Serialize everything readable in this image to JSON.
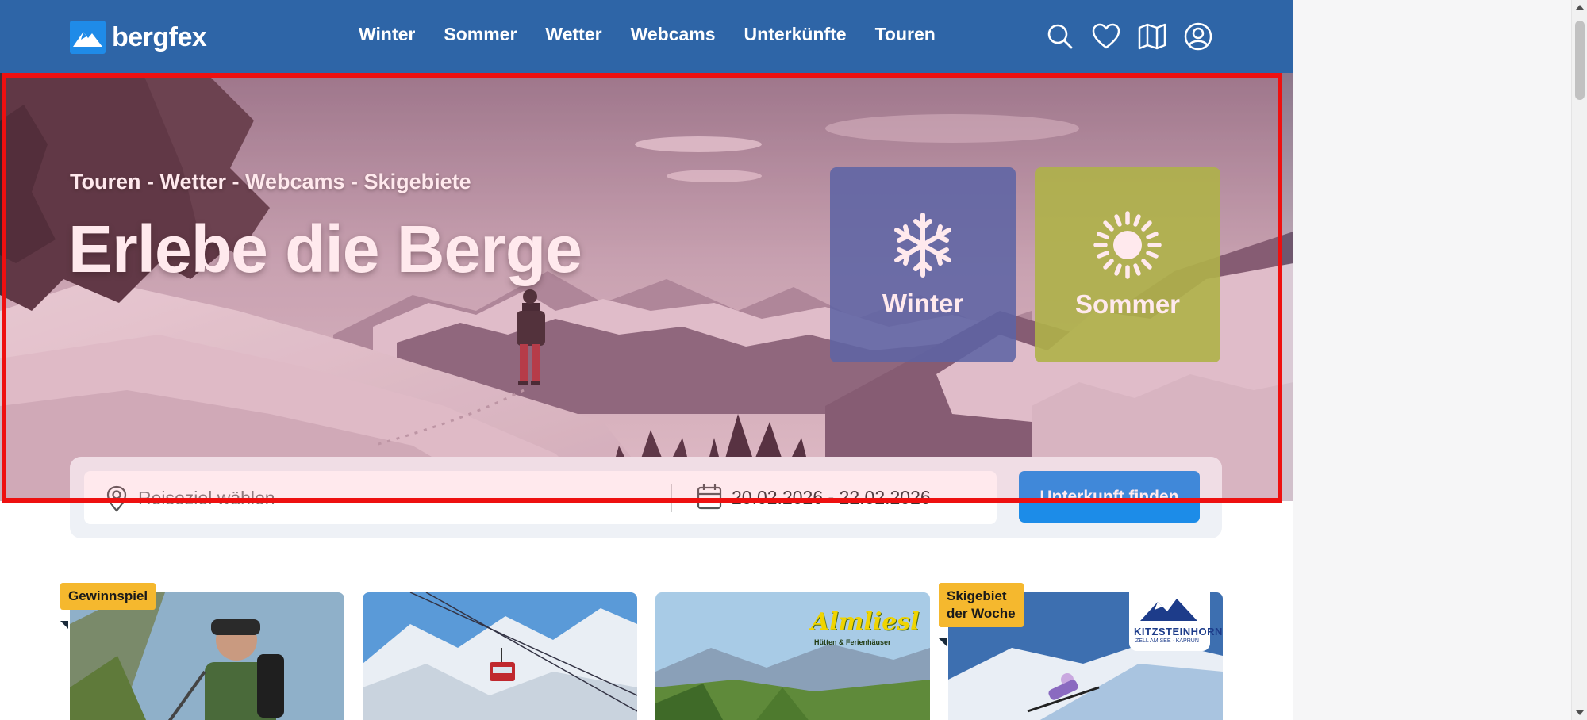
{
  "header": {
    "logo_text": "bergfex",
    "nav": [
      "Winter",
      "Sommer",
      "Wetter",
      "Webcams",
      "Unterkünfte",
      "Touren"
    ],
    "icons": [
      "search-icon",
      "heart-icon",
      "map-icon",
      "user-icon"
    ],
    "bg_color": "#2e65a7"
  },
  "hero": {
    "tagline": "Touren - Wetter - Webcams - Skigebiete",
    "title": "Erlebe die Berge",
    "cards": [
      {
        "label": "Winter",
        "icon": "snowflake-icon",
        "color": "#4061a8"
      },
      {
        "label": "Sommer",
        "icon": "sun-icon",
        "color": "#a0be3c"
      }
    ]
  },
  "search": {
    "destination_placeholder": "Reiseziel wählen",
    "dates": "20.02.2026 - 22.02.2026",
    "button_label": "Unterkunft finden",
    "button_color": "#1c8ce8"
  },
  "teasers": {
    "badge_1": "Gewinnspiel",
    "badge_4_line1": "Skigebiet",
    "badge_4_line2": "der Woche",
    "almliesl_logo": "Almliesl",
    "almliesl_sub": "Hütten & Ferienhäuser",
    "kitzsteinhorn_logo": "KITZSTEINHORN",
    "kitzsteinhorn_sub": "ZELL AM SEE · KAPRUN",
    "badge_color": "#f5b82e"
  }
}
